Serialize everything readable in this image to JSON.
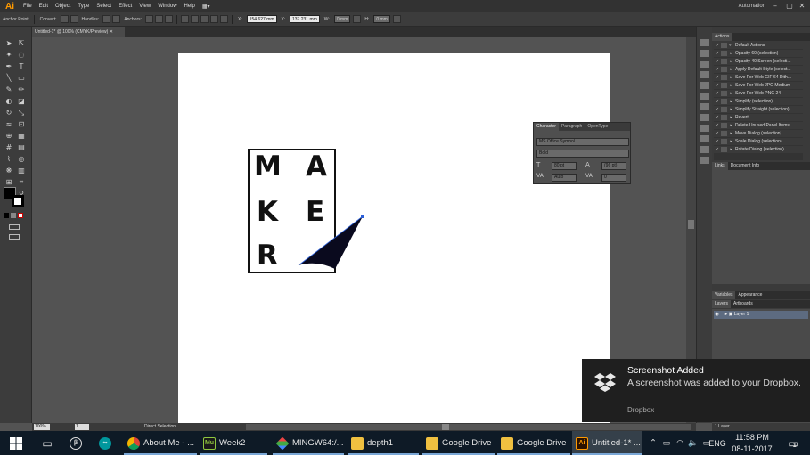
{
  "app": {
    "logo": "Ai"
  },
  "menu": [
    "File",
    "Edit",
    "Object",
    "Type",
    "Select",
    "Effect",
    "View",
    "Window",
    "Help"
  ],
  "workspace": "Automation",
  "control_bar": {
    "tool_name": "Anchor Point",
    "convert": "Convert:",
    "handles": "Handles:",
    "anchors": "Anchors:",
    "x_label": "X:",
    "x_value": "154.627 mm",
    "y_label": "Y:",
    "y_value": "137.231 mm",
    "w_label": "W:",
    "w_value": "0 mm",
    "h_label": "H:",
    "h_value": "0 mm"
  },
  "document": {
    "tab_title": "Untitled-1* @ 100% (CMYK/Preview)"
  },
  "artwork": {
    "letters": [
      "M",
      "A",
      "K",
      "E",
      "R"
    ]
  },
  "character_panel": {
    "tabs": [
      "Character",
      "Paragraph",
      "OpenType"
    ],
    "font_family": "MS Office Symbol",
    "font_style": "Bold",
    "font_size": "80 pt",
    "leading": "(96 pt)",
    "kerning": "Auto",
    "tracking": "0"
  },
  "actions_panel": {
    "title": "Actions",
    "set_name": "Default Actions",
    "items": [
      "Opacity 60 (selection)",
      "Opacity 40 Screen (selecti...",
      "Apply Default Style (select...",
      "Save For Web GIF 64 Dith...",
      "Save For Web JPG Medium",
      "Save For Web PNG 24",
      "Simplify (selection)",
      "Simplify Straight (selection)",
      "Revert",
      "Delete Unused Panel Items",
      "Move Dialog (selection)",
      "Scale Dialog (selection)",
      "Rotate Dialog (selection)"
    ]
  },
  "links_panel": {
    "tabs": [
      "Links",
      "Document Info"
    ]
  },
  "variables_panel": {
    "tabs": [
      "Variables",
      "Appearance"
    ]
  },
  "layers_panel": {
    "tabs": [
      "Layers",
      "Artboards"
    ],
    "layer_name": "Layer 1",
    "footer": "1 Layer"
  },
  "status_bar": {
    "zoom": "100%",
    "page": "1",
    "tool": "Direct Selection"
  },
  "notification": {
    "title": "Screenshot Added",
    "message": "A screenshot was added to your Dropbox.",
    "source": "Dropbox"
  },
  "taskbar": {
    "apps": [
      {
        "label": "About Me - ...",
        "icon": "chrome-icon"
      },
      {
        "label": "Week2",
        "icon": "muse-icon"
      },
      {
        "label": "MINGW64:/...",
        "icon": "git-bash-icon"
      },
      {
        "label": "depth1",
        "icon": "folder-icon"
      },
      {
        "label": "Google Drive",
        "icon": "folder-icon"
      },
      {
        "label": "Google Drive",
        "icon": "folder-icon"
      },
      {
        "label": "Untitled-1* ...",
        "icon": "illustrator-icon"
      }
    ],
    "language": "ENG",
    "time": "11:58 PM",
    "date": "08-11-2017",
    "notification_count": "1"
  },
  "colors": {
    "illustrator_orange": "#ff9a00",
    "taskbar": "#0e1a26",
    "toast_bg": "#1f1f1f"
  }
}
